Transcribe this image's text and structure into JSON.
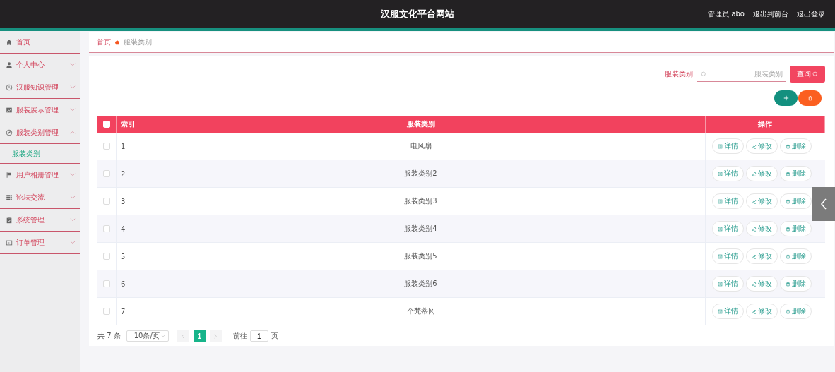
{
  "header": {
    "title": "汉服文化平台网站",
    "user": "管理员 abo",
    "links": [
      "退出到前台",
      "退出登录"
    ]
  },
  "sidebar": {
    "items": [
      {
        "label": "首页",
        "has_arrow": false
      },
      {
        "label": "个人中心",
        "expanded": false,
        "has_arrow": true
      },
      {
        "label": "汉服知识管理",
        "expanded": false,
        "has_arrow": true
      },
      {
        "label": "服装展示管理",
        "expanded": false,
        "has_arrow": true
      },
      {
        "label": "服装类别管理",
        "expanded": true,
        "has_arrow": true,
        "children": [
          {
            "label": "服装类别",
            "selected": true
          }
        ]
      },
      {
        "label": "用户相册管理",
        "expanded": false,
        "has_arrow": true
      },
      {
        "label": "论坛交流",
        "expanded": false,
        "has_arrow": true
      },
      {
        "label": "系统管理",
        "expanded": false,
        "has_arrow": true
      },
      {
        "label": "订单管理",
        "expanded": false,
        "has_arrow": true
      }
    ]
  },
  "breadcrumb": [
    "首页",
    "服装类别"
  ],
  "search": {
    "label": "服装类别",
    "placeholder": "服装类别",
    "button": "查询"
  },
  "table": {
    "header_checked": false,
    "columns": [
      "索引",
      "服装类别",
      "操作"
    ],
    "rows": [
      {
        "checked": false,
        "index": "1",
        "category": "电风扇",
        "actions": [
          "详情",
          "修改",
          "删除"
        ]
      },
      {
        "checked": false,
        "index": "2",
        "category": "服装类别2",
        "actions": [
          "详情",
          "修改",
          "删除"
        ]
      },
      {
        "checked": false,
        "index": "3",
        "category": "服装类别3",
        "actions": [
          "详情",
          "修改",
          "删除"
        ]
      },
      {
        "checked": false,
        "index": "4",
        "category": "服装类别4",
        "actions": [
          "详情",
          "修改",
          "删除"
        ]
      },
      {
        "checked": false,
        "index": "5",
        "category": "服装类别5",
        "actions": [
          "详情",
          "修改",
          "删除"
        ]
      },
      {
        "checked": false,
        "index": "6",
        "category": "服装类别6",
        "actions": [
          "详情",
          "修改",
          "删除"
        ]
      },
      {
        "checked": false,
        "index": "7",
        "category": "个梵蒂冈",
        "actions": [
          "详情",
          "修改",
          "删除"
        ]
      }
    ]
  },
  "pagination": {
    "total": "共 7 条",
    "page_size": "10条/页",
    "pages": [
      {
        "label": "1",
        "selected": true
      }
    ],
    "goto_label": "前往",
    "goto_value": "1",
    "goto_suffix": "页"
  }
}
